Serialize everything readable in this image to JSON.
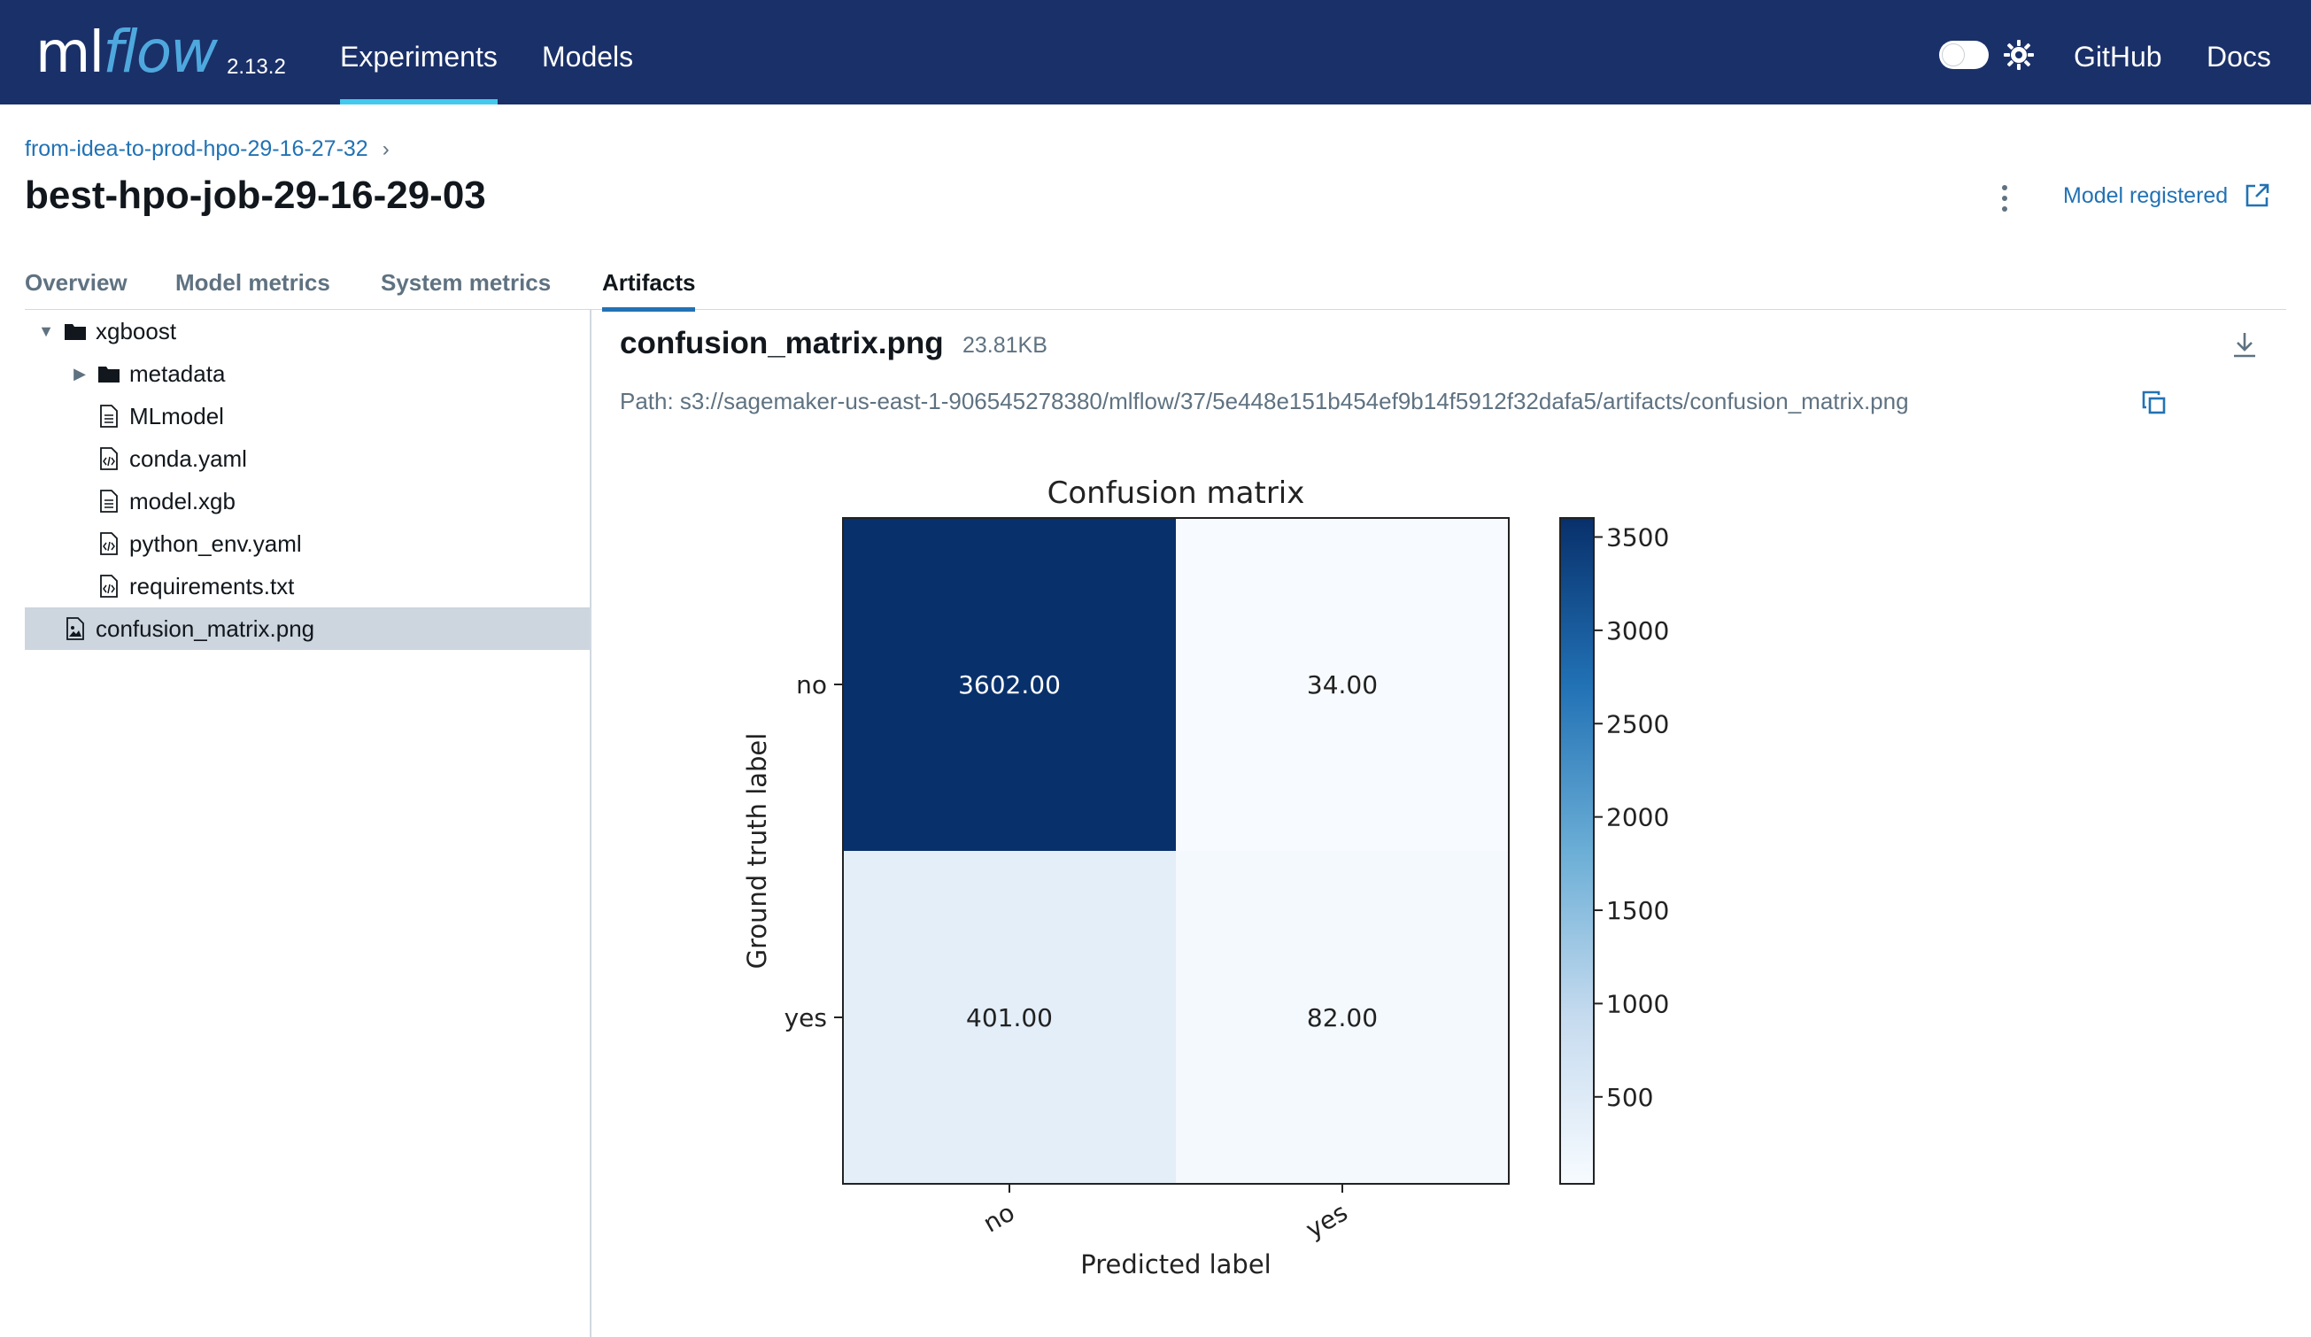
{
  "app": {
    "logo_ml": "ml",
    "logo_flow": "flow",
    "version": "2.13.2"
  },
  "nav": {
    "experiments": "Experiments",
    "models": "Models",
    "github": "GitHub",
    "docs": "Docs"
  },
  "header": {
    "breadcrumb": "from-idea-to-prod-hpo-29-16-27-32",
    "breadcrumb_chevron": "›",
    "title": "best-hpo-job-29-16-29-03",
    "model_registered": "Model registered"
  },
  "tabs": [
    {
      "label": "Overview"
    },
    {
      "label": "Model metrics"
    },
    {
      "label": "System metrics"
    },
    {
      "label": "Artifacts",
      "active": true
    }
  ],
  "tree": {
    "items": [
      {
        "label": "xgboost",
        "type": "folder",
        "expanded": true
      },
      {
        "label": "metadata",
        "type": "folder",
        "expanded": false
      },
      {
        "label": "MLmodel",
        "type": "file"
      },
      {
        "label": "conda.yaml",
        "type": "code-file"
      },
      {
        "label": "model.xgb",
        "type": "file"
      },
      {
        "label": "python_env.yaml",
        "type": "code-file"
      },
      {
        "label": "requirements.txt",
        "type": "code-file"
      },
      {
        "label": "confusion_matrix.png",
        "type": "image-file",
        "selected": true
      }
    ]
  },
  "artifact": {
    "name": "confusion_matrix.png",
    "size": "23.81KB",
    "path": "Path: s3://sagemaker-us-east-1-906545278380/mlflow/37/5e448e151b454ef9b14f5912f32dafa5/artifacts/confusion_matrix.png"
  },
  "icons": {
    "download": "download-icon",
    "copy": "copy-icon",
    "external_link": "external-link-icon",
    "theme_toggle": "theme-toggle",
    "gear": "sun-icon",
    "kebab": "kebab-menu-icon"
  },
  "colors": {
    "topbar": "#1a3069",
    "accent": "#2272b4",
    "nav_underline": "#43c9ed",
    "selected_row": "#cdd5de"
  },
  "chart_data": {
    "type": "heatmap",
    "title": "Confusion matrix",
    "xlabel": "Predicted label",
    "ylabel": "Ground truth label",
    "x_categories": [
      "no",
      "yes"
    ],
    "y_categories": [
      "no",
      "yes"
    ],
    "values": [
      [
        3602.0,
        34.0
      ],
      [
        401.0,
        82.0
      ]
    ],
    "cell_labels": [
      [
        "3602.00",
        "34.00"
      ],
      [
        "401.00",
        "82.00"
      ]
    ],
    "colorbar": {
      "min": 34,
      "max": 3602,
      "ticks": [
        500,
        1000,
        1500,
        2000,
        2500,
        3000,
        3500
      ],
      "tick_labels": [
        "500",
        "1000",
        "1500",
        "2000",
        "2500",
        "3000",
        "3500"
      ],
      "colormap": "Blues"
    }
  }
}
